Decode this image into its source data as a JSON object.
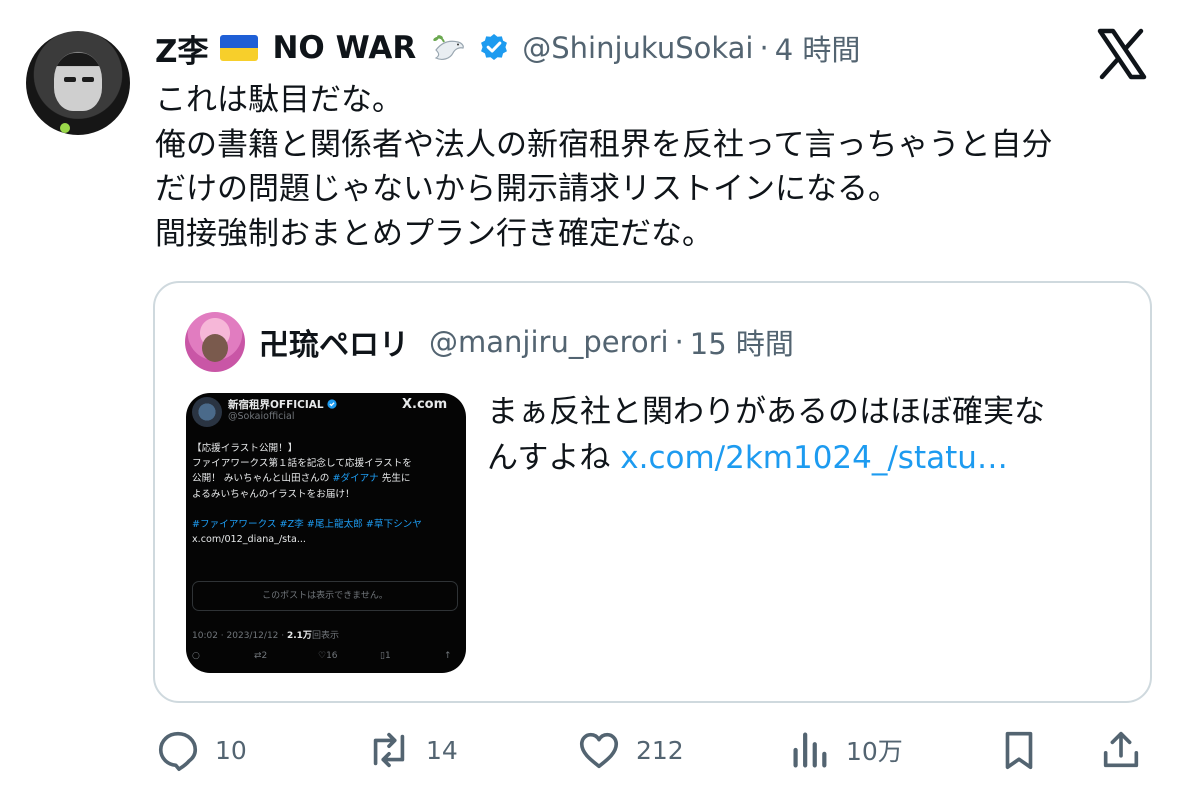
{
  "post": {
    "display_name": "Z李",
    "display_name_suffix": "NO WAR",
    "handle": "@ShinjukuSokai",
    "separator": "·",
    "time": "4 時間",
    "text_lines": [
      "これは駄目だな。",
      "俺の書籍と関係者や法人の新宿租界を反社って言っちゃうと自分",
      "だけの問題じゃないから開示請求リストインになる。",
      "間接強制おまとめプラン行き確定だな。"
    ]
  },
  "quoted": {
    "display_name": "卍琉ペロリ",
    "handle": "@manjiru_perori",
    "separator": "·",
    "time": "15 時間",
    "text_line1": "まぁ反社と関わりがあるのはほぼ確実な",
    "text_line2_prefix": "んすよね",
    "link": "x.com/2km1024_/statu…",
    "embedded_image": {
      "name": "新宿租界OFFICIAL",
      "handle": "@Sokaiofficial",
      "brand": "X.com",
      "lines": [
        "【応援イラスト公開！】",
        "ファイアワークス第１話を記念して応援イラストを",
        "公開！ みいちゃんと山田さんの",
        "#ダイアナ",
        "先生に",
        "よるみいちゃんのイラストをお届け！",
        "#ファイアワークス #Z李 #尾上龍太郎 #草下シンヤ",
        "x.com/012_diana_/sta..."
      ],
      "unavailable": "このポストは表示できません。",
      "meta_time": "10:02 · 2023/12/12 · ",
      "meta_views": "2.1万",
      "meta_views_suffix": "回表示",
      "retweets": "2",
      "likes": "16",
      "bookmarks": "1"
    }
  },
  "actions": {
    "replies": "10",
    "reposts": "14",
    "likes": "212",
    "views": "10万"
  },
  "colors": {
    "text": "#0f1419",
    "secondary": "#536471",
    "link": "#1d9bf0",
    "verified": "#1d9bf0",
    "border": "#cfd9de"
  },
  "icons": {
    "brand": "x-logo-icon",
    "verified": "verified-badge-icon",
    "dove": "dove-emoji-icon",
    "flag": "ukraine-flag-icon",
    "reply": "reply-icon",
    "repost": "repost-icon",
    "like": "heart-icon",
    "views": "views-icon",
    "bookmark": "bookmark-icon",
    "share": "share-icon"
  }
}
